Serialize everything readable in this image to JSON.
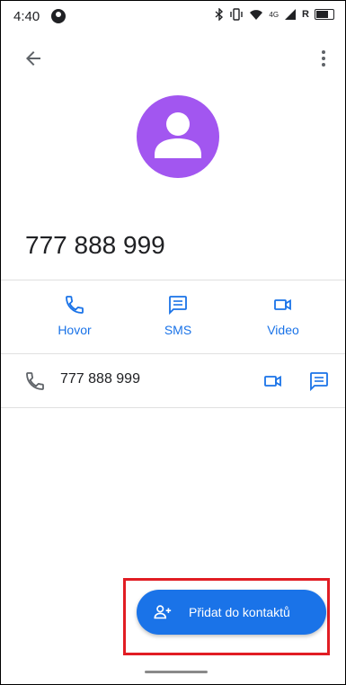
{
  "status_bar": {
    "time": "4:40",
    "right_icons": [
      "bluetooth-icon",
      "vibrate-icon",
      "wifi-icon",
      "signal-icon",
      "battery-icon"
    ],
    "network_text": "4G",
    "roaming_text": "R"
  },
  "app_bar": {
    "back_icon": "arrow-back-icon",
    "more_icon": "more-vert-icon"
  },
  "contact": {
    "avatar_color": "#a256f0",
    "phone_number": "777 888 999"
  },
  "actions": [
    {
      "label": "Hovor",
      "icon": "phone-icon"
    },
    {
      "label": "SMS",
      "icon": "message-icon"
    },
    {
      "label": "Video",
      "icon": "video-icon"
    }
  ],
  "number_row": {
    "number": "777 888 999",
    "icons": [
      "phone-icon",
      "video-icon",
      "message-icon"
    ]
  },
  "fab": {
    "label": "Přidat do kontaktů",
    "icon": "person-add-icon",
    "color": "#1a73e8"
  },
  "colors": {
    "accent": "#1a73e8",
    "highlight": "#e11d24"
  }
}
